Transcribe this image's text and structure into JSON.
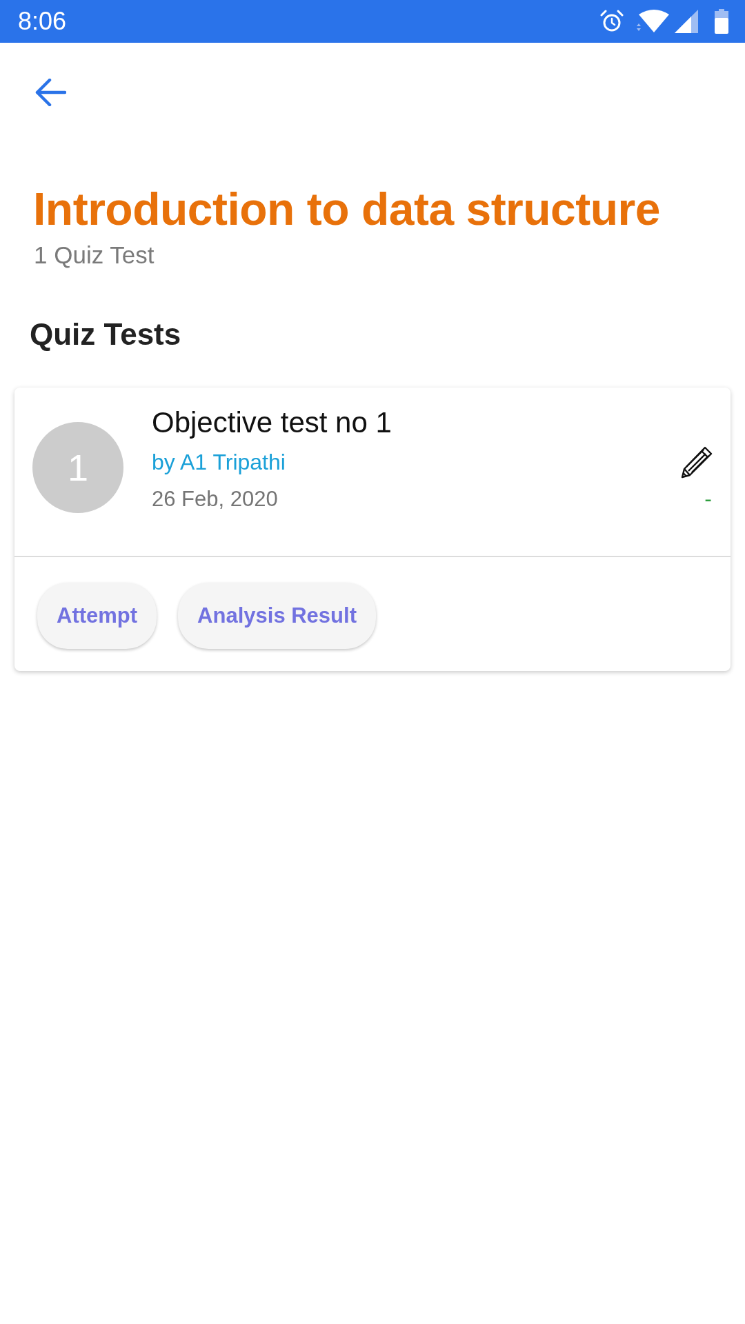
{
  "status_bar": {
    "time": "8:06"
  },
  "header": {
    "title": "Introduction to data structure",
    "subtitle": "1 Quiz Test"
  },
  "section_title": "Quiz Tests",
  "quizzes": [
    {
      "number": "1",
      "title": "Objective test no 1",
      "author": "by A1 Tripathi",
      "date": "26 Feb, 2020",
      "score": "-",
      "actions": [
        "Attempt",
        "Analysis Result"
      ]
    }
  ]
}
